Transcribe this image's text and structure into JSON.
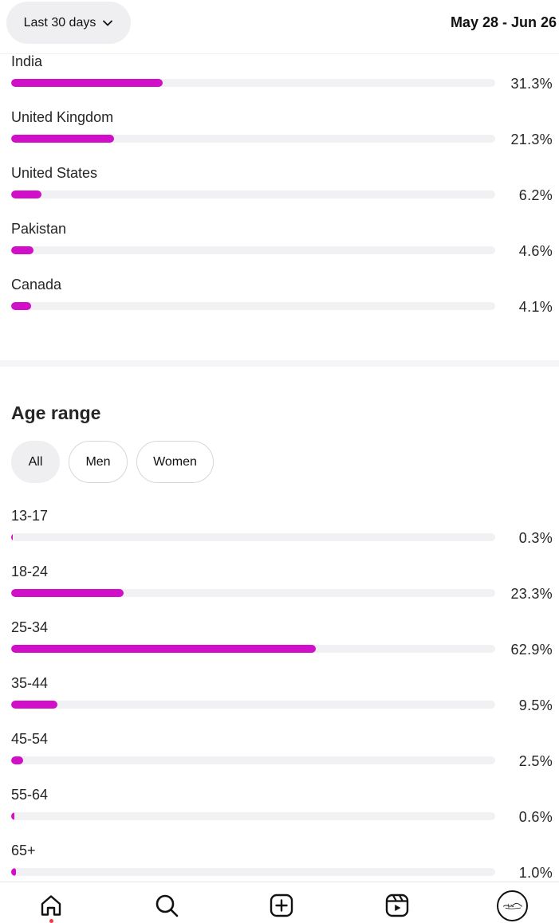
{
  "header": {
    "range_label": "Last 30 days",
    "date_range": "May 28 - Jun 26"
  },
  "countries": [
    {
      "label": "India",
      "percent_text": "31.3%",
      "value": 31.3
    },
    {
      "label": "United Kingdom",
      "percent_text": "21.3%",
      "value": 21.3
    },
    {
      "label": "United States",
      "percent_text": "6.2%",
      "value": 6.2
    },
    {
      "label": "Pakistan",
      "percent_text": "4.6%",
      "value": 4.6
    },
    {
      "label": "Canada",
      "percent_text": "4.1%",
      "value": 4.1
    }
  ],
  "age_section": {
    "title": "Age range",
    "filters": [
      {
        "label": "All",
        "active": true
      },
      {
        "label": "Men",
        "active": false
      },
      {
        "label": "Women",
        "active": false
      }
    ],
    "rows": [
      {
        "label": "13-17",
        "percent_text": "0.3%",
        "value": 0.3
      },
      {
        "label": "18-24",
        "percent_text": "23.3%",
        "value": 23.3
      },
      {
        "label": "25-34",
        "percent_text": "62.9%",
        "value": 62.9
      },
      {
        "label": "35-44",
        "percent_text": "9.5%",
        "value": 9.5
      },
      {
        "label": "45-54",
        "percent_text": "2.5%",
        "value": 2.5
      },
      {
        "label": "55-64",
        "percent_text": "0.6%",
        "value": 0.6
      },
      {
        "label": "65+",
        "percent_text": "1.0%",
        "value": 1.0
      }
    ]
  },
  "colors": {
    "bar_fill": "#d10fc8",
    "bar_track": "#f1f1f4",
    "notification_dot": "#ff3040"
  },
  "bottom_nav": {
    "icons": [
      "home-icon",
      "search-icon",
      "create-icon",
      "reels-icon",
      "profile-avatar"
    ],
    "home_has_notification": true
  }
}
